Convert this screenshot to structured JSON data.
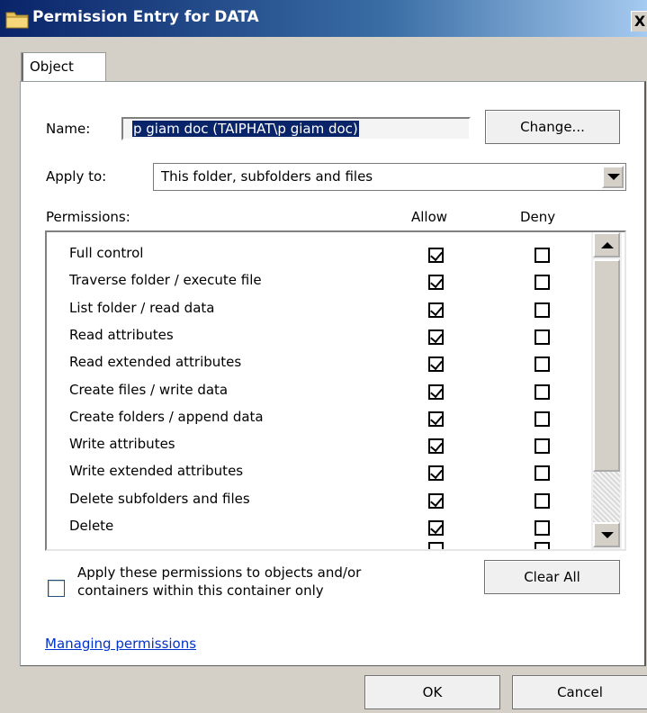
{
  "window": {
    "title": "Permission Entry for DATA",
    "close_label": "X"
  },
  "tabs": [
    {
      "label": "Object"
    }
  ],
  "name": {
    "label": "Name:",
    "value": "p giam doc (TAIPHAT\\p giam doc)",
    "change_label": "Change..."
  },
  "apply_to": {
    "label": "Apply to:",
    "value": "This folder, subfolders and files"
  },
  "permissions": {
    "label": "Permissions:",
    "allow_header": "Allow",
    "deny_header": "Deny",
    "rows": [
      {
        "name": "Full control",
        "allow": true,
        "deny": false
      },
      {
        "name": "Traverse folder / execute file",
        "allow": true,
        "deny": false
      },
      {
        "name": "List folder / read data",
        "allow": true,
        "deny": false
      },
      {
        "name": "Read attributes",
        "allow": true,
        "deny": false
      },
      {
        "name": "Read extended attributes",
        "allow": true,
        "deny": false
      },
      {
        "name": "Create files / write data",
        "allow": true,
        "deny": false
      },
      {
        "name": "Create folders / append data",
        "allow": true,
        "deny": false
      },
      {
        "name": "Write attributes",
        "allow": true,
        "deny": false
      },
      {
        "name": "Write extended attributes",
        "allow": true,
        "deny": false
      },
      {
        "name": "Delete subfolders and files",
        "allow": true,
        "deny": false
      },
      {
        "name": "Delete",
        "allow": true,
        "deny": false
      }
    ]
  },
  "apply_container": {
    "line1": "Apply these permissions to objects and/or",
    "line2": "containers within this container only",
    "checked": false
  },
  "clear_all_label": "Clear All",
  "managing_link": "Managing permissions",
  "footer": {
    "ok_label": "OK",
    "cancel_label": "Cancel"
  }
}
